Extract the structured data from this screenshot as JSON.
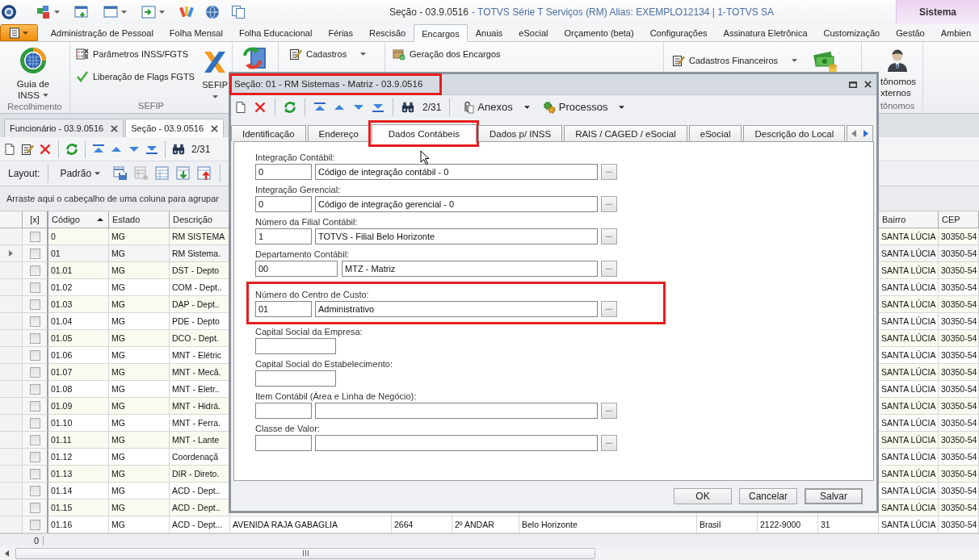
{
  "title_bar": {
    "title": "Seção - 03.9.0516",
    "subtitle": "- TOTVS Série T Serviços (RM) Alias: EXEMPLO12134 | 1-TOTVS SA",
    "context_tab": "Sistema"
  },
  "ribbon": {
    "tabs": [
      {
        "label": "Administração de Pessoal",
        "selected": false
      },
      {
        "label": "Folha Mensal",
        "selected": false
      },
      {
        "label": "Folha Educacional",
        "selected": false
      },
      {
        "label": "Férias",
        "selected": false
      },
      {
        "label": "Rescisão",
        "selected": false
      },
      {
        "label": "Encargos",
        "selected": true
      },
      {
        "label": "Anuais",
        "selected": false
      },
      {
        "label": "eSocial",
        "selected": false
      },
      {
        "label": "Orçamento (beta)",
        "selected": false
      },
      {
        "label": "Configurações",
        "selected": false
      },
      {
        "label": "Assinatura Eletrônica",
        "selected": false
      },
      {
        "label": "Customização",
        "selected": false
      },
      {
        "label": "Gestão",
        "selected": false
      },
      {
        "label": "Ambien",
        "selected": false
      }
    ],
    "groups": [
      {
        "label": "Recolhimento",
        "items": [
          {
            "kind": "large",
            "lines": [
              "Guia de",
              "INSS"
            ],
            "dropdown": true
          }
        ]
      },
      {
        "label": "SEFIP",
        "items": [
          {
            "kind": "small",
            "lines": [
              "Parâmetros INSS/FGTS"
            ],
            "dropdown": false
          },
          {
            "kind": "small",
            "lines": [
              "Liberação de Flags FGTS"
            ],
            "dropdown": false
          },
          {
            "kind": "large",
            "lines": [
              "SEFIP"
            ],
            "dropdown": true
          }
        ]
      },
      {
        "items": [
          {
            "kind": "small",
            "lines": [
              "Cadastros"
            ],
            "dropdown": true
          }
        ]
      },
      {
        "items": [
          {
            "kind": "small",
            "lines": [
              "Geração dos Encargos"
            ],
            "dropdown": false
          }
        ]
      },
      {
        "items": [
          {
            "kind": "small",
            "lines": [
              "Cadastros Financeiros"
            ],
            "dropdown": true
          }
        ]
      },
      {
        "label": "tônomos",
        "items": [
          {
            "kind": "large",
            "lines": [
              "tônomos",
              "xternos"
            ],
            "dropdown": false
          }
        ]
      }
    ]
  },
  "documents": {
    "tabs": [
      {
        "label": "Funcionário - 03.9.0516",
        "selected": false
      },
      {
        "label": "Seção - 03.9.0516",
        "selected": true
      }
    ],
    "counter": "2/31",
    "layout_label": "Layout:",
    "layout_value": "Padrão",
    "group_hint": "Arraste aqui o cabeçalho de uma coluna para agrupar"
  },
  "table": {
    "check_column": "[x]",
    "columns": [
      {
        "label": "Código",
        "sorted": true
      },
      {
        "label": "Estado",
        "sorted": false
      },
      {
        "label": "Descrição",
        "sorted": false
      },
      {
        "label": "Bairro",
        "sorted": false
      },
      {
        "label": "CEP",
        "sorted": false
      }
    ],
    "rows": [
      {
        "selected": false,
        "checked": false,
        "cells": [
          "0",
          "MG",
          "RM SISTEMA",
          "SANTA LÚCIA",
          "30350-54"
        ]
      },
      {
        "selected": true,
        "checked": false,
        "cells": [
          "01",
          "MG",
          "RM Sistema.",
          "SANTA LÚCIA",
          "30350-54"
        ]
      },
      {
        "selected": false,
        "checked": false,
        "cells": [
          "01.01",
          "MG",
          "DST - Depto",
          "SANTA LÚCIA",
          "30350-54"
        ]
      },
      {
        "selected": false,
        "checked": false,
        "cells": [
          "01.02",
          "MG",
          "COM - Dept..",
          "SANTA LÚCIA",
          "30350-54"
        ]
      },
      {
        "selected": false,
        "checked": false,
        "cells": [
          "01.03",
          "MG",
          "DAP - Dept..",
          "SANTA LÚCIA",
          "30350-54"
        ]
      },
      {
        "selected": false,
        "checked": false,
        "cells": [
          "01.04",
          "MG",
          "PDE - Depto",
          "SANTA LÚCIA",
          "30350-54"
        ]
      },
      {
        "selected": false,
        "checked": false,
        "cells": [
          "01.05",
          "MG",
          "DCO - Dept.",
          "SANTA LÚCIA",
          "30350-54"
        ]
      },
      {
        "selected": false,
        "checked": false,
        "cells": [
          "01.06",
          "MG",
          "MNT - Elétric",
          "SANTA LÚCIA",
          "30350-54"
        ]
      },
      {
        "selected": false,
        "checked": false,
        "cells": [
          "01.07",
          "MG",
          "MNT - Mecâ.",
          "SANTA LÚCIA",
          "30350-54"
        ]
      },
      {
        "selected": false,
        "checked": false,
        "cells": [
          "01.08",
          "MG",
          "MNT - Eletr..",
          "SANTA LÚCIA",
          "30350-54"
        ]
      },
      {
        "selected": false,
        "checked": false,
        "cells": [
          "01.09",
          "MG",
          "MNT - Hidrá.",
          "SANTA LÚCIA",
          "30350-54"
        ]
      },
      {
        "selected": false,
        "checked": false,
        "cells": [
          "01.10",
          "MG",
          "MNT - Ferra.",
          "SANTA LÚCIA",
          "30350-54"
        ]
      },
      {
        "selected": false,
        "checked": false,
        "cells": [
          "01.11",
          "MG",
          "MNT - Lante",
          "SANTA LÚCIA",
          "30350-54"
        ]
      },
      {
        "selected": false,
        "checked": false,
        "cells": [
          "01.12",
          "MG",
          "Coordenaçã",
          "SANTA LÚCIA",
          "30350-54"
        ]
      },
      {
        "selected": false,
        "checked": false,
        "cells": [
          "01.13",
          "MG",
          "DIR - Direto.",
          "SANTA LÚCIA",
          "30350-54"
        ]
      },
      {
        "selected": false,
        "checked": false,
        "cells": [
          "01.14",
          "MG",
          "ACD - Dept..",
          "SANTA LÚCIA",
          "30350-54"
        ]
      },
      {
        "selected": false,
        "checked": false,
        "cells": [
          "01.15",
          "MG",
          "ACD - Dept..",
          "SANTA LÚCIA",
          "30350-54"
        ]
      },
      {
        "selected": false,
        "checked": false,
        "cells": [
          "01.16",
          "MG",
          "ACD - Dept...",
          "SANTA LÚCIA",
          "30350-54"
        ],
        "middle_cells": [
          "AVENIDA RAJA GABAGLIA",
          "2664",
          "2º ANDAR",
          "Belo Horizonte",
          "Brasil",
          "2122-9000",
          "31"
        ]
      }
    ],
    "footer": "0"
  },
  "dialog": {
    "title": "Seção: 01 - RM Sistemas - Matriz - 03.9.0516",
    "title_highlighted": true,
    "counter": "2/31",
    "menus": [
      {
        "label": "Anexos"
      },
      {
        "label": "Processos"
      }
    ],
    "tabs": [
      {
        "label": "Identificação",
        "selected": false,
        "highlighted": false
      },
      {
        "label": "Endereço",
        "selected": false,
        "highlighted": false
      },
      {
        "label": "Dados Contábeis",
        "selected": true,
        "highlighted": true
      },
      {
        "label": "Dados p/ INSS",
        "selected": false,
        "highlighted": false
      },
      {
        "label": "RAIS / CAGED / eSocial",
        "selected": false,
        "highlighted": false
      },
      {
        "label": "eSocial",
        "selected": false,
        "highlighted": false
      },
      {
        "label": "Descrição do Local",
        "selected": false,
        "highlighted": false
      }
    ],
    "fields": [
      {
        "kind": "lookup",
        "label": "Integração Contábil:",
        "code": "0",
        "description": "Código de integração contábil - 0",
        "browse": "...",
        "highlighted": false
      },
      {
        "kind": "lookup",
        "label": "Integração Gerencial:",
        "code": "0",
        "description": "Código de integração gerencial - 0",
        "browse": "...",
        "highlighted": false
      },
      {
        "kind": "lookup",
        "label": "Número da Filial Contábil:",
        "code": "1",
        "description": "TOTVS - Filial Belo Horizonte",
        "browse": "...",
        "highlighted": false
      },
      {
        "kind": "wide",
        "label": "Departamento Contábil:",
        "code": "00",
        "description": "MTZ - Matriz",
        "browse": "...",
        "highlighted": false
      },
      {
        "kind": "lookup",
        "label": "Número do Centro de Custo:",
        "code": "01",
        "description": "Administrativo",
        "browse": "...",
        "highlighted": true
      },
      {
        "kind": "amount",
        "label": "Capital Social da Empresa:",
        "highlighted": false
      },
      {
        "kind": "amount",
        "label": "Capital Social do Estabelecimento:",
        "highlighted": false
      },
      {
        "kind": "lookup",
        "label": "Item Contábil (Área e Linha de Negócio):",
        "browse": "...",
        "highlighted": false
      },
      {
        "kind": "lookup",
        "label": "Classe de Valor:",
        "browse": "...",
        "highlighted": false
      }
    ],
    "buttons": [
      {
        "label": "OK",
        "default": false
      },
      {
        "label": "Cancelar",
        "default": false
      },
      {
        "label": "Salvar",
        "default": true
      }
    ]
  }
}
